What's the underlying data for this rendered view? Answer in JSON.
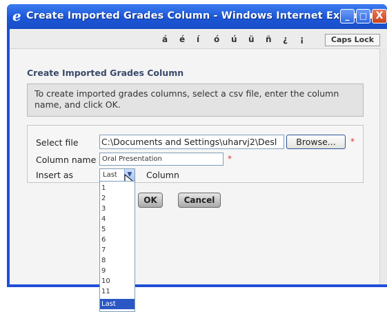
{
  "window": {
    "title": "Create Imported Grades Column - Windows Internet Explorer",
    "minimize_glyph": "_",
    "maximize_glyph": "□",
    "close_glyph": "X"
  },
  "toolbar": {
    "special_chars": [
      "á",
      "é",
      "í",
      "ó",
      "ú",
      "ü",
      "ñ",
      "¿",
      "¡"
    ],
    "caps_lock_label": "Caps Lock"
  },
  "page": {
    "title": "Create Imported Grades Column",
    "instructions": "To create imported grades columns, select a csv file, enter the column name, and click OK."
  },
  "form": {
    "select_file_label": "Select file",
    "file_path_value": "C:\\Documents and Settings\\uharvj2\\Desl",
    "browse_label": "Browse...",
    "column_name_label": "Column name",
    "column_name_value": "Oral Presentation",
    "insert_as_label": "Insert as",
    "insert_as_value": "Last",
    "column_suffix": "Column",
    "required_marker": "*",
    "ok_label": "OK",
    "cancel_label": "Cancel"
  },
  "dropdown": {
    "options": [
      "1",
      "2",
      "3",
      "4",
      "5",
      "6",
      "7",
      "8",
      "9",
      "10",
      "11",
      "Last"
    ],
    "selected": "Last"
  },
  "colors": {
    "titlebar": "#1b56d6",
    "selection": "#2a57c4"
  }
}
